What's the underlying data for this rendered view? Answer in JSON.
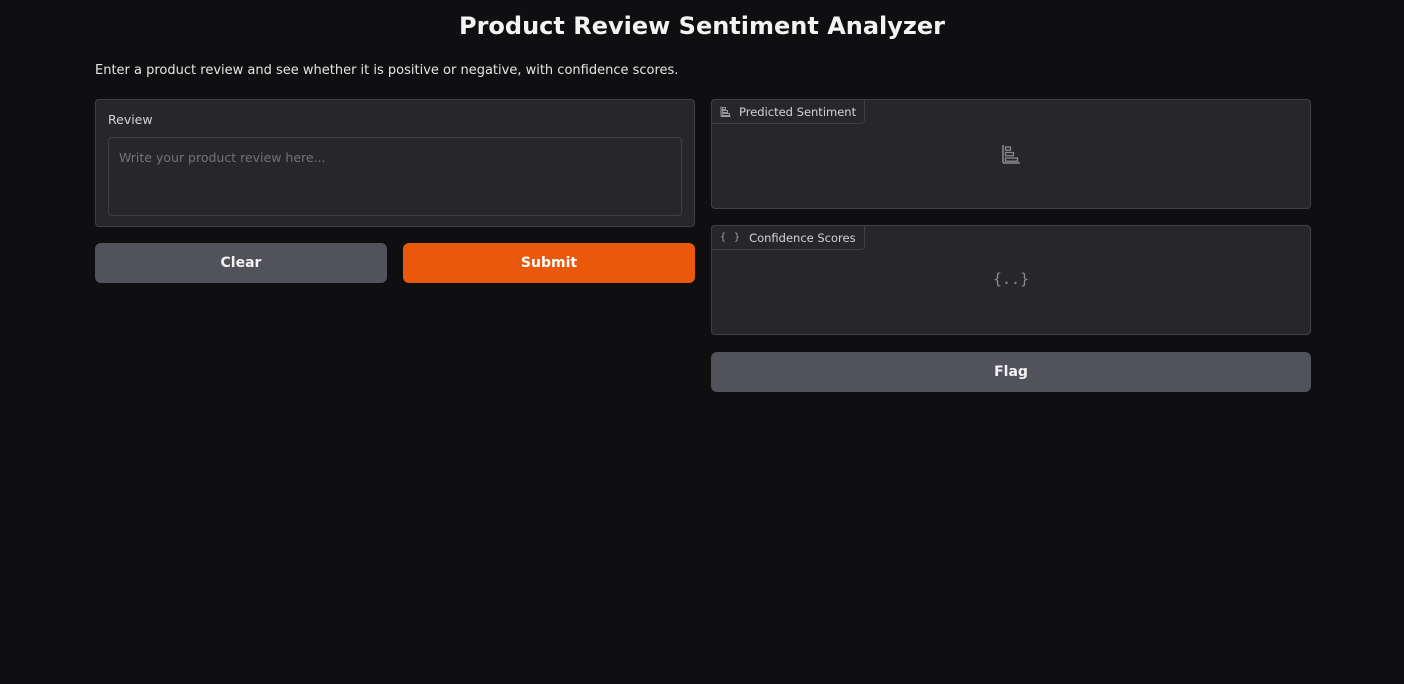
{
  "app": {
    "title": "Product Review Sentiment Analyzer",
    "description": "Enter a product review and see whether it is positive or negative, with confidence scores."
  },
  "input": {
    "label": "Review",
    "value": "",
    "placeholder": "Write your product review here..."
  },
  "actions": {
    "clear_label": "Clear",
    "submit_label": "Submit",
    "flag_label": "Flag"
  },
  "outputs": {
    "sentiment": {
      "label": "Predicted Sentiment",
      "icon": "bar-chart-icon"
    },
    "confidence": {
      "label": "Confidence Scores",
      "icon": "json-braces-icon",
      "empty_glyph": "{..}",
      "tab_glyph": "{ }"
    }
  },
  "colors": {
    "background": "#0f0f11",
    "panel": "#27272a",
    "border": "#3f3f46",
    "primary": "#ea580c",
    "secondary": "#52525b"
  }
}
